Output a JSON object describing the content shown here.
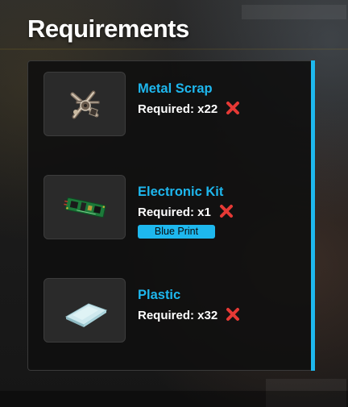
{
  "title": "Requirements",
  "items": [
    {
      "name": "Metal Scrap",
      "required": "Required: x22",
      "status_icon": "cross-mark-icon",
      "image": "metal-scrap-icon"
    },
    {
      "name": "Electronic Kit",
      "required": "Required: x1",
      "status_icon": "cross-mark-icon",
      "image": "circuit-board-icon",
      "badge": "Blue Print"
    },
    {
      "name": "Plastic",
      "required": "Required: x32",
      "status_icon": "cross-mark-icon",
      "image": "plastic-sheet-icon"
    }
  ],
  "colors": {
    "accent": "#1eb8ee",
    "missing": "#e53935",
    "panel": "#101010",
    "text": "#ffffff"
  }
}
